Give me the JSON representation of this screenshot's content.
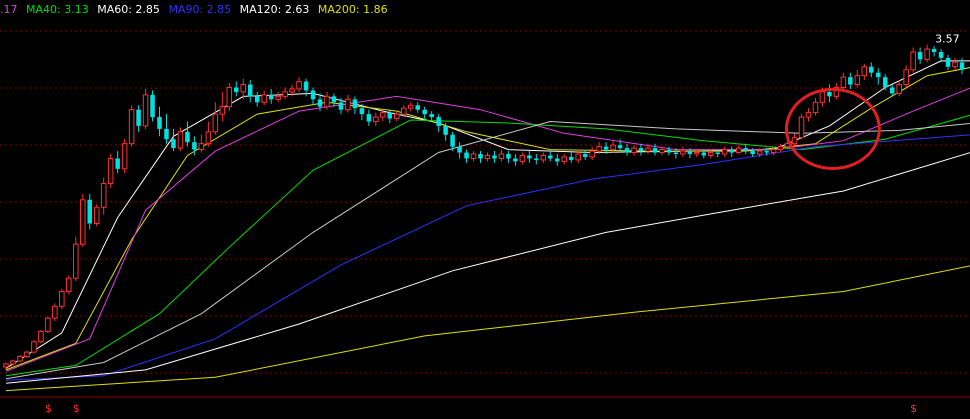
{
  "legend": {
    "ma_prev": {
      "text": ".17",
      "color": "#e040e0"
    },
    "ma40": {
      "text": "MA40: 3.13",
      "color": "#00e000"
    },
    "ma60": {
      "text": "MA60: 2.85",
      "color": "#ffffff"
    },
    "ma90": {
      "text": "MA90: 2.85",
      "color": "#3030ff"
    },
    "ma120": {
      "text": "MA120: 2.63",
      "color": "#ffffff"
    },
    "ma200": {
      "text": "MA200: 1.86",
      "color": "#e0e000"
    }
  },
  "chart_data": {
    "type": "candlestick",
    "y_range": [
      1.2,
      3.75
    ],
    "grid": "dotted-red-horizontal",
    "peak_label": "3.57",
    "up_color": "#ff3030",
    "down_color": "#00e0e0",
    "bottom_markers": [
      {
        "index": 6,
        "text": "$"
      },
      {
        "index": 10,
        "text": "$"
      },
      {
        "index": 130,
        "text": "$"
      }
    ],
    "candles": [
      [
        1.39,
        1.41,
        1.37,
        1.42
      ],
      [
        1.41,
        1.43,
        1.4,
        1.44
      ],
      [
        1.43,
        1.46,
        1.42,
        1.47
      ],
      [
        1.46,
        1.49,
        1.45,
        1.5
      ],
      [
        1.49,
        1.56,
        1.48,
        1.57
      ],
      [
        1.56,
        1.63,
        1.55,
        1.64
      ],
      [
        1.63,
        1.72,
        1.62,
        1.73
      ],
      [
        1.72,
        1.8,
        1.7,
        1.82
      ],
      [
        1.8,
        1.9,
        1.78,
        1.92
      ],
      [
        1.9,
        1.99,
        1.88,
        2.01
      ],
      [
        1.99,
        2.22,
        1.97,
        2.27
      ],
      [
        2.22,
        2.52,
        2.2,
        2.56
      ],
      [
        2.52,
        2.36,
        2.32,
        2.56
      ],
      [
        2.36,
        2.47,
        2.34,
        2.49
      ],
      [
        2.47,
        2.63,
        2.42,
        2.67
      ],
      [
        2.63,
        2.8,
        2.6,
        2.83
      ],
      [
        2.8,
        2.73,
        2.7,
        2.85
      ],
      [
        2.73,
        2.9,
        2.7,
        2.93
      ],
      [
        2.9,
        3.13,
        2.88,
        3.16
      ],
      [
        3.13,
        3.02,
        2.98,
        3.16
      ],
      [
        3.02,
        3.23,
        3.0,
        3.27
      ],
      [
        3.23,
        3.08,
        3.05,
        3.26
      ],
      [
        3.08,
        3.0,
        2.95,
        3.15
      ],
      [
        3.0,
        2.93,
        2.9,
        3.1
      ],
      [
        2.93,
        2.87,
        2.85,
        3.0
      ],
      [
        2.87,
        2.98,
        2.85,
        3.01
      ],
      [
        2.98,
        2.91,
        2.88,
        3.05
      ],
      [
        2.91,
        2.86,
        2.82,
        2.95
      ],
      [
        2.86,
        2.9,
        2.84,
        2.96
      ],
      [
        2.9,
        2.98,
        2.88,
        3.05
      ],
      [
        2.98,
        3.1,
        2.96,
        3.18
      ],
      [
        3.1,
        3.15,
        3.05,
        3.25
      ],
      [
        3.15,
        3.28,
        3.12,
        3.31
      ],
      [
        3.28,
        3.25,
        3.22,
        3.32
      ],
      [
        3.25,
        3.3,
        3.2,
        3.34
      ],
      [
        3.3,
        3.22,
        3.18,
        3.33
      ],
      [
        3.22,
        3.18,
        3.15,
        3.25
      ],
      [
        3.18,
        3.23,
        3.16,
        3.26
      ],
      [
        3.23,
        3.2,
        3.17,
        3.27
      ],
      [
        3.2,
        3.22,
        3.18,
        3.25
      ],
      [
        3.22,
        3.25,
        3.2,
        3.28
      ],
      [
        3.25,
        3.27,
        3.22,
        3.3
      ],
      [
        3.27,
        3.32,
        3.25,
        3.35
      ],
      [
        3.32,
        3.26,
        3.22,
        3.34
      ],
      [
        3.26,
        3.2,
        3.16,
        3.28
      ],
      [
        3.2,
        3.15,
        3.12,
        3.24
      ],
      [
        3.15,
        3.22,
        3.13,
        3.25
      ],
      [
        3.22,
        3.18,
        3.15,
        3.24
      ],
      [
        3.18,
        3.13,
        3.1,
        3.21
      ],
      [
        3.13,
        3.2,
        3.11,
        3.23
      ],
      [
        3.2,
        3.14,
        3.1,
        3.22
      ],
      [
        3.14,
        3.1,
        3.06,
        3.17
      ],
      [
        3.1,
        3.05,
        3.02,
        3.13
      ],
      [
        3.05,
        3.08,
        3.02,
        3.11
      ],
      [
        3.08,
        3.11,
        3.05,
        3.13
      ],
      [
        3.11,
        3.07,
        3.04,
        3.13
      ],
      [
        3.07,
        3.1,
        3.05,
        3.12
      ],
      [
        3.1,
        3.14,
        3.08,
        3.16
      ],
      [
        3.14,
        3.16,
        3.12,
        3.18
      ],
      [
        3.16,
        3.13,
        3.11,
        3.18
      ],
      [
        3.13,
        3.1,
        3.06,
        3.15
      ],
      [
        3.1,
        3.08,
        3.05,
        3.12
      ],
      [
        3.08,
        3.02,
        2.98,
        3.1
      ],
      [
        3.02,
        2.96,
        2.92,
        3.04
      ],
      [
        2.96,
        2.88,
        2.85,
        2.98
      ],
      [
        2.88,
        2.84,
        2.8,
        2.91
      ],
      [
        2.84,
        2.8,
        2.77,
        2.86
      ],
      [
        2.8,
        2.83,
        2.78,
        2.85
      ],
      [
        2.83,
        2.8,
        2.77,
        2.85
      ],
      [
        2.8,
        2.82,
        2.78,
        2.84
      ],
      [
        2.82,
        2.8,
        2.77,
        2.85
      ],
      [
        2.8,
        2.83,
        2.78,
        2.86
      ],
      [
        2.83,
        2.8,
        2.77,
        2.85
      ],
      [
        2.8,
        2.78,
        2.75,
        2.83
      ],
      [
        2.78,
        2.82,
        2.76,
        2.84
      ],
      [
        2.82,
        2.8,
        2.77,
        2.85
      ],
      [
        2.8,
        2.79,
        2.76,
        2.83
      ],
      [
        2.79,
        2.82,
        2.77,
        2.84
      ],
      [
        2.82,
        2.8,
        2.78,
        2.85
      ],
      [
        2.8,
        2.78,
        2.75,
        2.83
      ],
      [
        2.78,
        2.81,
        2.76,
        2.83
      ],
      [
        2.81,
        2.79,
        2.77,
        2.84
      ],
      [
        2.79,
        2.83,
        2.77,
        2.85
      ],
      [
        2.83,
        2.81,
        2.79,
        2.86
      ],
      [
        2.81,
        2.85,
        2.79,
        2.88
      ],
      [
        2.85,
        2.88,
        2.83,
        2.91
      ],
      [
        2.88,
        2.86,
        2.83,
        2.91
      ],
      [
        2.86,
        2.89,
        2.84,
        2.92
      ],
      [
        2.89,
        2.87,
        2.84,
        2.93
      ],
      [
        2.87,
        2.84,
        2.82,
        2.9
      ],
      [
        2.84,
        2.87,
        2.82,
        2.89
      ],
      [
        2.87,
        2.85,
        2.82,
        2.9
      ],
      [
        2.85,
        2.87,
        2.83,
        2.9
      ],
      [
        2.87,
        2.84,
        2.82,
        2.9
      ],
      [
        2.84,
        2.86,
        2.82,
        2.88
      ],
      [
        2.86,
        2.84,
        2.82,
        2.88
      ],
      [
        2.84,
        2.83,
        2.8,
        2.87
      ],
      [
        2.83,
        2.85,
        2.81,
        2.88
      ],
      [
        2.85,
        2.83,
        2.8,
        2.87
      ],
      [
        2.83,
        2.84,
        2.81,
        2.86
      ],
      [
        2.84,
        2.82,
        2.8,
        2.86
      ],
      [
        2.82,
        2.84,
        2.8,
        2.86
      ],
      [
        2.84,
        2.83,
        2.81,
        2.86
      ],
      [
        2.83,
        2.86,
        2.81,
        2.88
      ],
      [
        2.86,
        2.84,
        2.81,
        2.88
      ],
      [
        2.84,
        2.87,
        2.83,
        2.89
      ],
      [
        2.87,
        2.85,
        2.83,
        2.9
      ],
      [
        2.85,
        2.83,
        2.81,
        2.87
      ],
      [
        2.83,
        2.85,
        2.81,
        2.87
      ],
      [
        2.85,
        2.84,
        2.82,
        2.87
      ],
      [
        2.84,
        2.86,
        2.82,
        2.88
      ],
      [
        2.86,
        2.88,
        2.84,
        2.9
      ],
      [
        2.88,
        2.9,
        2.86,
        2.93
      ],
      [
        2.9,
        2.94,
        2.88,
        2.97
      ],
      [
        2.94,
        3.08,
        2.93,
        3.1
      ],
      [
        3.08,
        3.11,
        3.05,
        3.14
      ],
      [
        3.11,
        3.18,
        3.09,
        3.21
      ],
      [
        3.18,
        3.25,
        3.15,
        3.28
      ],
      [
        3.25,
        3.22,
        3.18,
        3.3
      ],
      [
        3.22,
        3.28,
        3.2,
        3.31
      ],
      [
        3.28,
        3.35,
        3.25,
        3.38
      ],
      [
        3.35,
        3.3,
        3.27,
        3.38
      ],
      [
        3.3,
        3.36,
        3.28,
        3.4
      ],
      [
        3.36,
        3.42,
        3.33,
        3.44
      ],
      [
        3.42,
        3.38,
        3.35,
        3.45
      ],
      [
        3.38,
        3.35,
        3.3,
        3.41
      ],
      [
        3.35,
        3.28,
        3.26,
        3.37
      ],
      [
        3.28,
        3.24,
        3.22,
        3.3
      ],
      [
        3.24,
        3.3,
        3.22,
        3.33
      ],
      [
        3.3,
        3.4,
        3.28,
        3.43
      ],
      [
        3.4,
        3.52,
        3.38,
        3.55
      ],
      [
        3.52,
        3.47,
        3.44,
        3.55
      ],
      [
        3.47,
        3.54,
        3.45,
        3.57
      ],
      [
        3.54,
        3.52,
        3.49,
        3.56
      ],
      [
        3.52,
        3.48,
        3.45,
        3.54
      ],
      [
        3.48,
        3.42,
        3.4,
        3.5
      ],
      [
        3.42,
        3.45,
        3.4,
        3.48
      ],
      [
        3.45,
        3.4,
        3.37,
        3.48
      ]
    ],
    "moving_averages": [
      {
        "color": "#ffffff",
        "points": [
          [
            0,
            1.38
          ],
          [
            8,
            1.62
          ],
          [
            16,
            2.4
          ],
          [
            24,
            2.95
          ],
          [
            34,
            3.22
          ],
          [
            44,
            3.24
          ],
          [
            54,
            3.12
          ],
          [
            62,
            3.04
          ],
          [
            72,
            2.86
          ],
          [
            84,
            2.84
          ],
          [
            98,
            2.85
          ],
          [
            110,
            2.86
          ],
          [
            118,
            3.02
          ],
          [
            126,
            3.28
          ],
          [
            134,
            3.46
          ],
          [
            141,
            3.46
          ]
        ]
      },
      {
        "color": "#e0e000",
        "points": [
          [
            0,
            1.37
          ],
          [
            10,
            1.55
          ],
          [
            18,
            2.25
          ],
          [
            26,
            2.82
          ],
          [
            36,
            3.1
          ],
          [
            46,
            3.18
          ],
          [
            56,
            3.12
          ],
          [
            66,
            2.98
          ],
          [
            78,
            2.86
          ],
          [
            92,
            2.85
          ],
          [
            106,
            2.85
          ],
          [
            116,
            2.9
          ],
          [
            124,
            3.14
          ],
          [
            132,
            3.36
          ],
          [
            141,
            3.44
          ]
        ]
      },
      {
        "color": "#e040e0",
        "points": [
          [
            0,
            1.36
          ],
          [
            12,
            1.58
          ],
          [
            20,
            2.45
          ],
          [
            30,
            2.85
          ],
          [
            42,
            3.12
          ],
          [
            56,
            3.22
          ],
          [
            68,
            3.13
          ],
          [
            80,
            2.97
          ],
          [
            96,
            2.86
          ],
          [
            110,
            2.86
          ],
          [
            120,
            2.92
          ],
          [
            130,
            3.12
          ],
          [
            141,
            3.33
          ]
        ]
      },
      {
        "color": "#00e000",
        "points": [
          [
            0,
            1.33
          ],
          [
            10,
            1.4
          ],
          [
            22,
            1.75
          ],
          [
            32,
            2.2
          ],
          [
            44,
            2.72
          ],
          [
            58,
            3.06
          ],
          [
            72,
            3.04
          ],
          [
            86,
            3.0
          ],
          [
            100,
            2.92
          ],
          [
            114,
            2.86
          ],
          [
            126,
            2.93
          ],
          [
            141,
            3.13
          ]
        ]
      },
      {
        "color": "#c8c8c8",
        "points": [
          [
            0,
            1.31
          ],
          [
            14,
            1.42
          ],
          [
            28,
            1.75
          ],
          [
            44,
            2.3
          ],
          [
            62,
            2.84
          ],
          [
            78,
            3.05
          ],
          [
            96,
            3.0
          ],
          [
            114,
            2.97
          ],
          [
            128,
            2.99
          ],
          [
            141,
            3.05
          ]
        ]
      },
      {
        "color": "#3030ff",
        "points": [
          [
            0,
            1.3
          ],
          [
            14,
            1.33
          ],
          [
            30,
            1.58
          ],
          [
            48,
            2.08
          ],
          [
            66,
            2.48
          ],
          [
            84,
            2.66
          ],
          [
            100,
            2.76
          ],
          [
            116,
            2.88
          ],
          [
            130,
            2.93
          ],
          [
            141,
            2.97
          ]
        ]
      },
      {
        "color": "#ffffff",
        "points": [
          [
            0,
            1.28
          ],
          [
            20,
            1.37
          ],
          [
            42,
            1.68
          ],
          [
            64,
            2.04
          ],
          [
            86,
            2.3
          ],
          [
            104,
            2.45
          ],
          [
            120,
            2.58
          ],
          [
            141,
            2.88
          ]
        ]
      },
      {
        "color": "#e0e000",
        "points": [
          [
            0,
            1.23
          ],
          [
            30,
            1.32
          ],
          [
            60,
            1.6
          ],
          [
            90,
            1.76
          ],
          [
            120,
            1.9
          ],
          [
            141,
            2.1
          ]
        ]
      }
    ],
    "annotation_circle": {
      "from_index": 113,
      "to_index": 124,
      "price_low": 2.8,
      "price_high": 3.2,
      "color": "#e02020"
    }
  }
}
